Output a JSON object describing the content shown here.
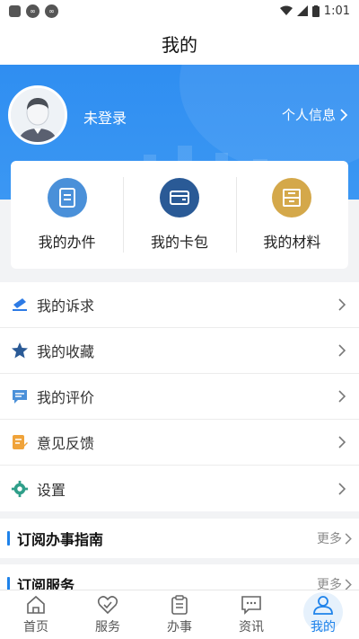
{
  "status_bar": {
    "time": "1:01"
  },
  "header": {
    "title": "我的"
  },
  "profile": {
    "login_text": "未登录",
    "link_label": "个人信息"
  },
  "quick_actions": [
    {
      "label": "我的办件",
      "icon": "document-icon",
      "color": "#4a90d9"
    },
    {
      "label": "我的卡包",
      "icon": "wallet-icon",
      "color": "#2a5a96"
    },
    {
      "label": "我的材料",
      "icon": "archive-icon",
      "color": "#d4a84a"
    }
  ],
  "menu": [
    {
      "label": "我的诉求",
      "icon": "ticket-icon",
      "color": "#2d7be5"
    },
    {
      "label": "我的收藏",
      "icon": "star-icon",
      "color": "#2a5a96"
    },
    {
      "label": "我的评价",
      "icon": "comment-icon",
      "color": "#4a90d9"
    },
    {
      "label": "意见反馈",
      "icon": "edit-icon",
      "color": "#f0a33a"
    },
    {
      "label": "设置",
      "icon": "gear-icon",
      "color": "#2f9f8a"
    }
  ],
  "sections": [
    {
      "title": "订阅办事指南",
      "more": "更多"
    },
    {
      "title": "订阅服务",
      "more": "更多"
    }
  ],
  "tabbar": [
    {
      "label": "首页",
      "icon": "home-icon"
    },
    {
      "label": "服务",
      "icon": "service-icon"
    },
    {
      "label": "办事",
      "icon": "clipboard-icon"
    },
    {
      "label": "资讯",
      "icon": "news-icon"
    },
    {
      "label": "我的",
      "icon": "user-icon",
      "active": true
    }
  ],
  "colors": {
    "primary": "#1e82ea",
    "hero": "#2f8ef1"
  }
}
